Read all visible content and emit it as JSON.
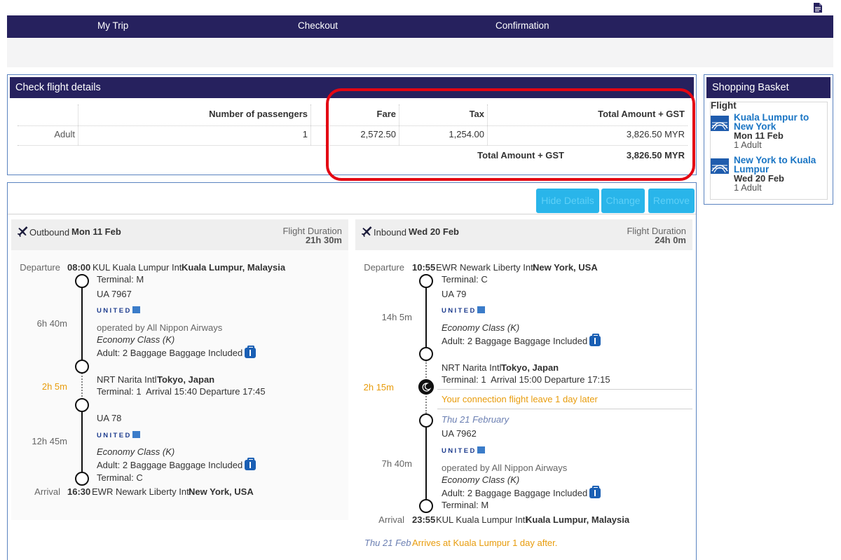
{
  "nav": {
    "steps": [
      "My Trip",
      "Checkout",
      "Confirmation"
    ]
  },
  "fare": {
    "title": "Check flight details",
    "headers": [
      "Number of passengers",
      "Fare",
      "Tax",
      "Total Amount + GST"
    ],
    "row": {
      "type": "Adult",
      "passengers": "1",
      "fare": "2,572.50",
      "tax": "1,254.00",
      "total": "3,826.50 MYR"
    },
    "summary_label": "Total Amount + GST",
    "summary_value": "3,826.50 MYR"
  },
  "basket": {
    "title": "Shopping Basket",
    "section": "Flight",
    "items": [
      {
        "route_line1": "Kuala Lumpur to",
        "route_line2": "New York",
        "date": "Mon 11 Feb",
        "pax": "1 Adult"
      },
      {
        "route_line1": "New York to Kuala",
        "route_line2": "Lumpur",
        "date": "Wed 20 Feb",
        "pax": "1 Adult"
      }
    ]
  },
  "actions": {
    "hide_details": "Hide Details",
    "change": "Change",
    "remove": "Remove"
  },
  "outbound": {
    "direction": "Outbound",
    "date": "Mon 11 Feb",
    "duration_label": "Flight Duration",
    "duration": "21h 30m",
    "departure_label": "Departure",
    "departure_time": "08:00",
    "departure_airport": "KUL Kuala Lumpur Intl",
    "departure_city": "Kuala Lumpur, Malaysia",
    "seg1": {
      "terminal": "Terminal: M",
      "flight_no": "UA 7967",
      "airline": "UNITED",
      "duration": "6h 40m",
      "operated_by": "operated by All Nippon Airways",
      "cabin": "Economy Class (K)",
      "baggage": "Adult: 2 Baggage Baggage Included"
    },
    "connection": {
      "layover": "2h 5m",
      "airport": "NRT Narita Intl",
      "city": "Tokyo, Japan",
      "times": "Terminal: 1  Arrival 15:40 Departure 17:45"
    },
    "seg2": {
      "flight_no": "UA 78",
      "airline": "UNITED",
      "duration": "12h 45m",
      "cabin": "Economy Class (K)",
      "baggage": "Adult: 2 Baggage Baggage Included",
      "terminal": "Terminal: C"
    },
    "arrival_label": "Arrival",
    "arrival_time": "16:30",
    "arrival_airport": "EWR Newark Liberty Intl",
    "arrival_city": "New York, USA"
  },
  "inbound": {
    "direction": "Inbound",
    "date": "Wed 20 Feb",
    "duration_label": "Flight Duration",
    "duration": "24h 0m",
    "departure_label": "Departure",
    "departure_time": "10:55",
    "departure_airport": "EWR Newark Liberty Intl",
    "departure_city": "New York, USA",
    "seg1": {
      "terminal": "Terminal: C",
      "flight_no": "UA 79",
      "airline": "UNITED",
      "duration": "14h 5m",
      "cabin": "Economy Class (K)",
      "baggage": "Adult: 2 Baggage Baggage Included"
    },
    "connection": {
      "layover": "2h 15m",
      "airport": "NRT Narita Intl",
      "city": "Tokyo, Japan",
      "times": "Terminal: 1  Arrival 15:00 Departure 17:15",
      "warning": "Your connection flight leave 1 day later"
    },
    "seg2": {
      "date": "Thu 21 February",
      "flight_no": "UA 7962",
      "airline": "UNITED",
      "duration": "7h 40m",
      "operated_by": "operated by All Nippon Airways",
      "cabin": "Economy Class (K)",
      "baggage": "Adult: 2 Baggage Baggage Included",
      "terminal": "Terminal: M"
    },
    "arrival_label": "Arrival",
    "arrival_time": "23:55",
    "arrival_airport": "KUL Kuala Lumpur Intl",
    "arrival_city": "Kuala Lumpur, Malaysia",
    "arrival_note_date": "Thu 21 Feb",
    "arrival_note": "Arrives at Kuala Lumpur 1 day after."
  }
}
